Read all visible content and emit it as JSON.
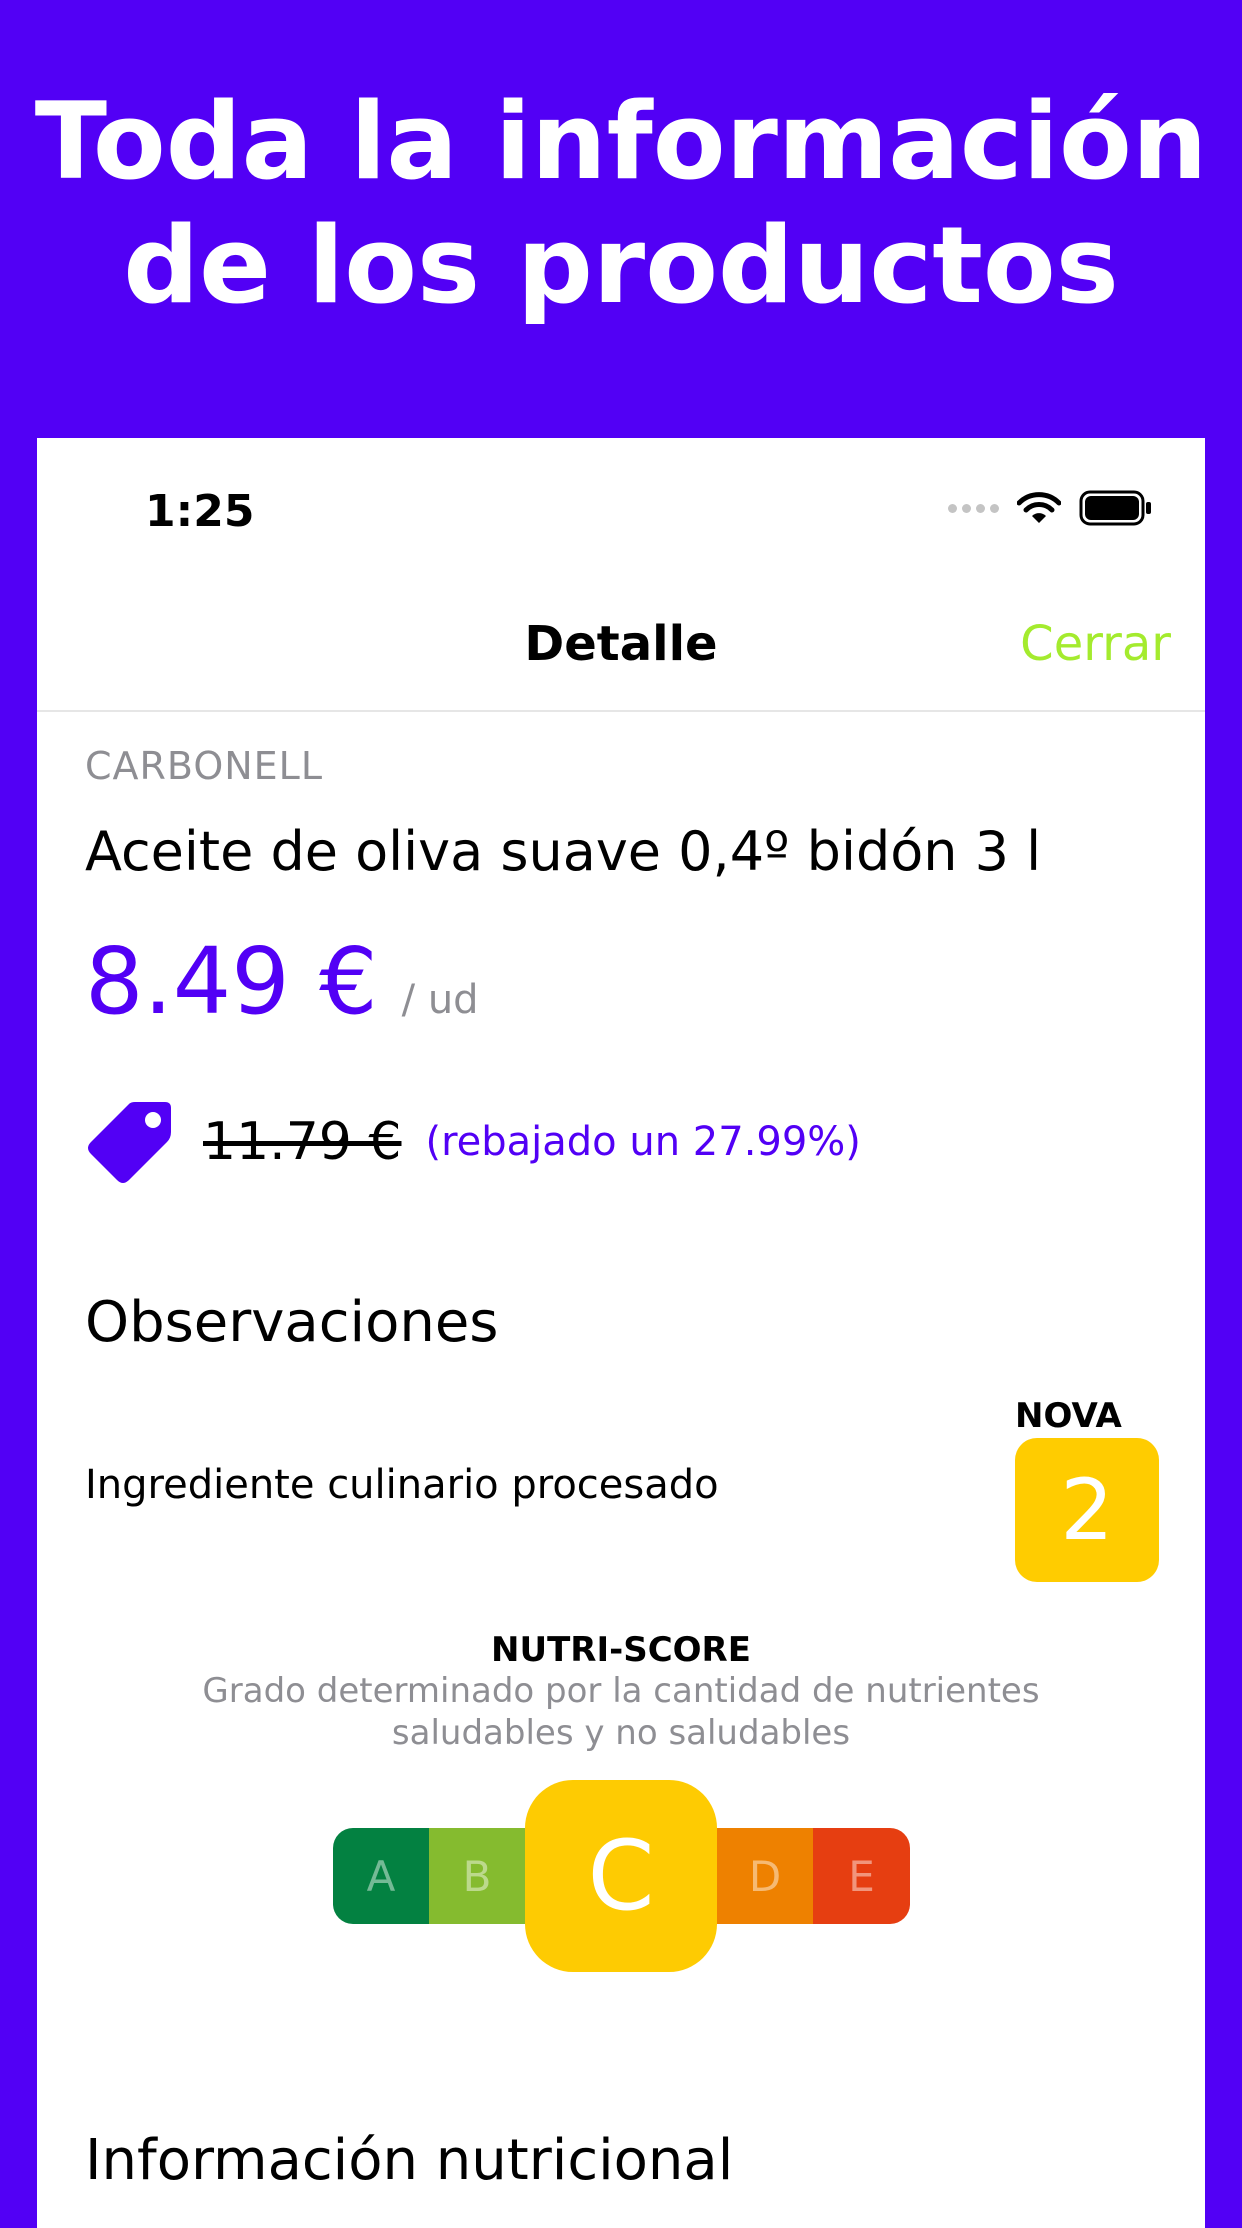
{
  "headline": {
    "line1": "Toda la información",
    "line2": "de los productos"
  },
  "status_bar": {
    "time": "1:25",
    "icons": [
      "cellular-signal-icon",
      "wifi-icon",
      "battery-icon"
    ]
  },
  "navbar": {
    "title": "Detalle",
    "close_label": "Cerrar"
  },
  "product": {
    "brand": "CARBONELL",
    "name": "Aceite de oliva suave 0,4º bidón 3 l",
    "price": "8.49 €",
    "unit": "/ ud",
    "old_price": "11.79 €",
    "discount_text": "(rebajado un 27.99%)",
    "tag_icon": "price-tag-icon"
  },
  "observations": {
    "title": "Observaciones",
    "text": "Ingrediente culinario procesado",
    "nova_label": "NOVA",
    "nova_value": "2"
  },
  "nutriscore": {
    "title": "NUTRI-SCORE",
    "subtitle_line1": "Grado determinado por la cantidad de nutrientes",
    "subtitle_line2": "saludables y no saludables",
    "grades": [
      "A",
      "B",
      "C",
      "D",
      "E"
    ],
    "selected": "C",
    "colors": [
      "#038141",
      "#85BB2F",
      "#FECB02",
      "#EE8100",
      "#E63E11"
    ]
  },
  "nutrition": {
    "title": "Información nutricional"
  },
  "colors": {
    "brand_purple": "#5200F5",
    "close_green": "#A4EB2E",
    "nova_yellow": "#FFCC00"
  }
}
